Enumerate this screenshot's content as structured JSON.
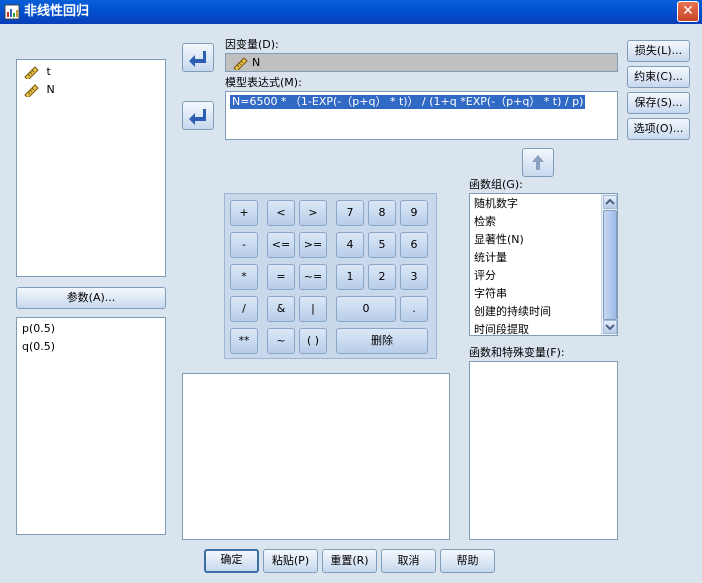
{
  "window": {
    "title": "非线性回归",
    "close_symbol": "✕"
  },
  "variables": {
    "items": [
      {
        "name": "t"
      },
      {
        "name": "N"
      }
    ]
  },
  "params_button": "参数(A)...",
  "params": {
    "items": [
      "p(0.5)",
      "q(0.5)"
    ]
  },
  "dependent": {
    "label": "因变量(D):",
    "value": "N"
  },
  "expression": {
    "label": "模型表达式(M):",
    "value": "N=6500 * （1-EXP(-（p+q） * t)） / (1+q *EXP(-（p+q） * t) / p)"
  },
  "side_buttons": [
    "损失(L)...",
    "约束(C)...",
    "保存(S)...",
    "选项(O)..."
  ],
  "keypad": {
    "rows": [
      [
        "+",
        "<",
        ">",
        "7",
        "8",
        "9"
      ],
      [
        "-",
        "<=",
        ">=",
        "4",
        "5",
        "6"
      ],
      [
        "*",
        "=",
        "~=",
        "1",
        "2",
        "3"
      ],
      [
        "/",
        "&",
        "|",
        "0",
        "."
      ],
      [
        "**",
        "~",
        "( )",
        "删除"
      ]
    ]
  },
  "function_group": {
    "label": "函数组(G):",
    "items": [
      "随机数字",
      "检索",
      "显著性(N)",
      "统计量",
      "评分",
      "字符串",
      "创建的持续时间",
      "时间段提取"
    ]
  },
  "functions_special": {
    "label": "函数和特殊变量(F):"
  },
  "bottom_buttons": [
    "确定",
    "粘贴(P)",
    "重置(R)",
    "取消",
    "帮助"
  ],
  "colors": {
    "background": "#d9e4ef",
    "titlebar": "#0050d0",
    "selection": "#316ac5"
  }
}
